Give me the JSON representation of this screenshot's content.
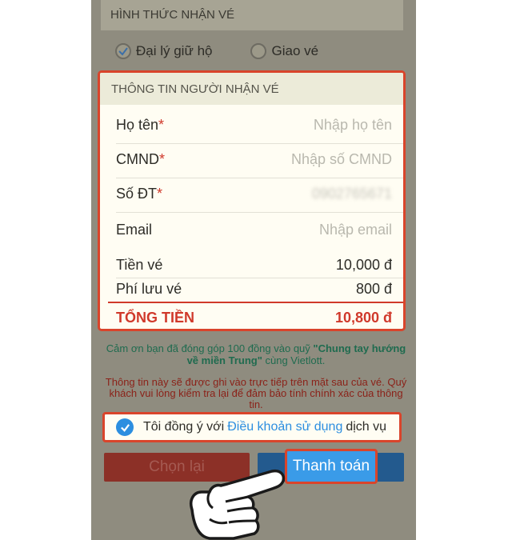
{
  "delivery_section": {
    "title": "HÌNH THỨC NHẬN VÉ",
    "options": [
      {
        "label": "Đại lý giữ hộ",
        "selected": true
      },
      {
        "label": "Giao vé",
        "selected": false
      }
    ]
  },
  "recipient_card": {
    "title": "THÔNG TIN NGƯỜI NHẬN VÉ",
    "fields": [
      {
        "label": "Họ tên",
        "required_mark": "*",
        "placeholder": "Nhập họ tên"
      },
      {
        "label": "CMND",
        "required_mark": "*",
        "placeholder": "Nhập số CMND"
      },
      {
        "label": "Số ĐT",
        "required_mark": "*",
        "value": "0902765671"
      },
      {
        "label": "Email",
        "required_mark": "",
        "placeholder": "Nhập email"
      }
    ],
    "ticket_price_label": "Tiền vé",
    "ticket_price_value": "10,000 đ",
    "storage_fee_label": "Phí lưu vé",
    "storage_fee_value": "800 đ",
    "total_label": "TỔNG TIỀN",
    "total_value": "10,800 đ"
  },
  "thanks_note": {
    "prefix": "Cảm ơn bạn đã đóng góp 100 đồng vào quỹ ",
    "campaign": "\"Chung tay hướng về miền Trung\"",
    "suffix": " cùng Vietlott."
  },
  "warning_note": "Thông tin này sẽ được ghi vào trực tiếp trên mặt sau của vé. Quý khách vui lòng kiểm tra lại để đảm bảo tính chính xác của thông tin.",
  "agreement": {
    "prefix": "Tôi đồng ý với",
    "link": "Điều khoản sử dụng",
    "suffix": "dịch vụ",
    "checked": true
  },
  "buttons": {
    "reset_label": "Chọn lại",
    "pay_label": "Thanh toán"
  },
  "colors": {
    "highlight_border": "#d9442b",
    "accent_blue": "#3a9be8",
    "total_red": "#d0392b"
  }
}
